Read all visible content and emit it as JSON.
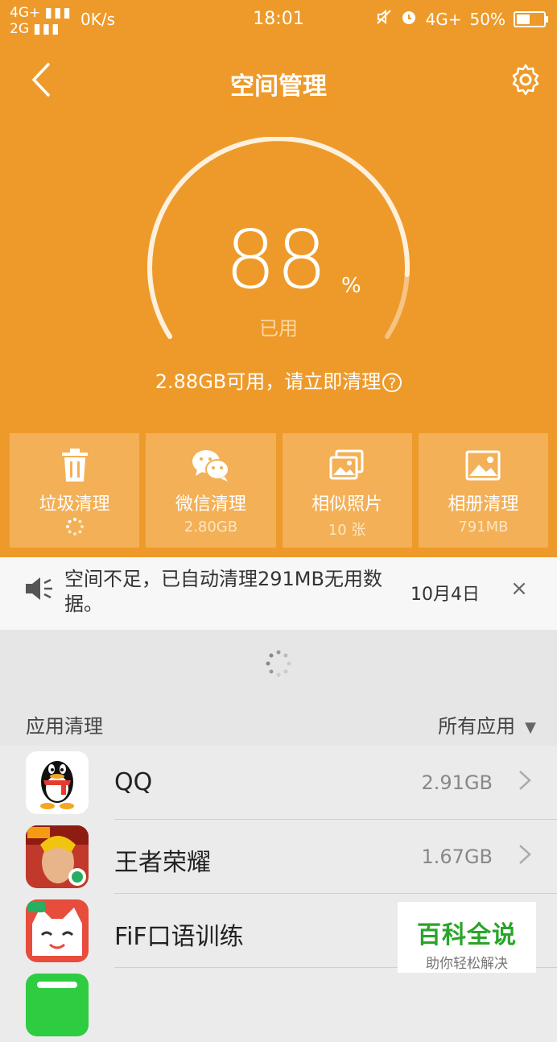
{
  "status_bar": {
    "network_top": "4G+",
    "network_bottom": "2G",
    "speed": "0K/s",
    "time": "18:01",
    "network_right": "4G+",
    "battery": "50%",
    "battery_level": 0.5
  },
  "header": {
    "title": "空间管理"
  },
  "storage": {
    "used_percent": 88,
    "value": "88",
    "percent_sign": "%",
    "used_label": "已用",
    "available_text": "2.88GB可用，请立即清理",
    "help_icon": "?"
  },
  "tiles": [
    {
      "label": "垃圾清理",
      "sub": "",
      "icon": "trash-icon"
    },
    {
      "label": "微信清理",
      "sub": "2.80GB",
      "icon": "wechat-icon"
    },
    {
      "label": "相似照片",
      "sub": "10 张",
      "icon": "photos-icon"
    },
    {
      "label": "相册清理",
      "sub": "791MB",
      "icon": "image-icon"
    }
  ],
  "notice": {
    "text": "空间不足，已自动清理291MB无用数据。",
    "date": "10月4日",
    "close": "×"
  },
  "apps_section": {
    "title": "应用清理",
    "filter": "所有应用",
    "filter_arrow": "▼"
  },
  "apps": [
    {
      "name": "QQ",
      "size": "2.91GB"
    },
    {
      "name": "王者荣耀",
      "size": "1.67GB"
    },
    {
      "name": "FiF口语训练",
      "size": ""
    }
  ],
  "watermark": {
    "title": "百科全说",
    "subtitle": "助你轻松解决"
  },
  "colors": {
    "accent": "#ee9a2a",
    "tile": "#f3b057"
  }
}
